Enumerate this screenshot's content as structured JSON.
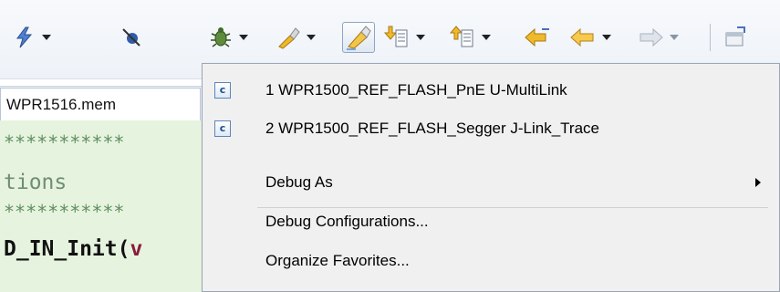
{
  "toolbar": {
    "icons": [
      "lightning-icon",
      "skip-breakpoints-icon",
      "debug-icon",
      "external-tools-icon",
      "highlight-icon",
      "next-annotation-icon",
      "previous-annotation-icon",
      "last-edit-location-icon",
      "back-icon",
      "forward-icon",
      "maximize-icon"
    ],
    "pressed_button": "highlight-icon"
  },
  "editor": {
    "tab_label": "WPR1516.mem",
    "lines": [
      {
        "text": "***********",
        "style": "star"
      },
      {
        "text": "tions",
        "style": "text"
      },
      {
        "text": "***********",
        "style": "star"
      },
      {
        "text": "D_IN_Init(",
        "style": "fn",
        "tail": "v"
      }
    ]
  },
  "menu": {
    "favorites": [
      {
        "label": "1 WPR1500_REF_FLASH_PnE U-MultiLink",
        "icon_text": "c"
      },
      {
        "label": "2 WPR1500_REF_FLASH_Segger J-Link_Trace",
        "icon_text": "c"
      }
    ],
    "debug_as_label": "Debug As",
    "debug_configurations_label": "Debug Configurations...",
    "organize_favorites_label": "Organize Favorites..."
  },
  "colors": {
    "menu_bg": "#f0f0f0",
    "editor_bg": "#e6f3df",
    "toolbar_bg": "#eef2f8",
    "icon_gold": "#f0b92a",
    "icon_blue": "#4a6fbf"
  }
}
